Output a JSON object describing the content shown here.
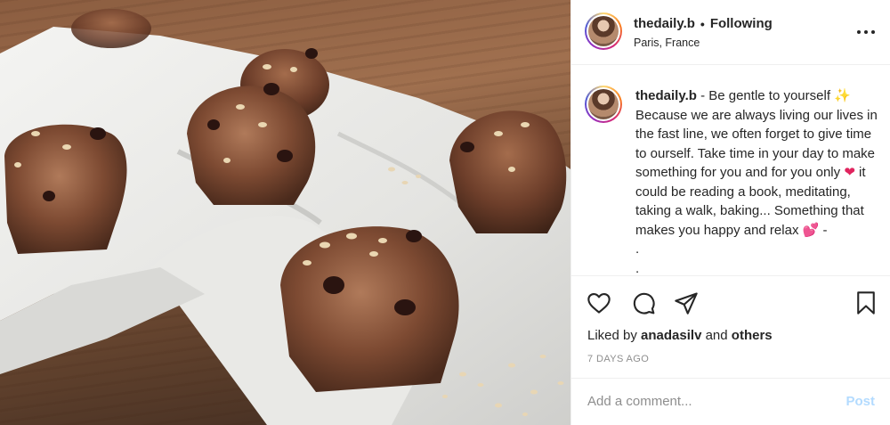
{
  "post": {
    "username": "thedaily.b",
    "separator": "•",
    "follow_status": "Following",
    "location": "Paris, France",
    "caption_user": "thedaily.b",
    "caption_lines": [
      " - Be gentle to yourself ",
      "Because we are always living our lives in the fast line, we often forget to give time to ourself. Take time in your day to make something for you and for you only ",
      " it could be reading a book, meditating, taking a walk, baking... Something that makes you happy and relax ",
      " -",
      ".",
      "."
    ],
    "emoji": {
      "sparkle": "✨",
      "red_heart": "❤",
      "pink_hearts": "💕"
    },
    "likes_prefix": "Liked by",
    "likes_user": "anadasilv",
    "likes_and": "and",
    "likes_others": "others",
    "timestamp": "7 DAYS AGO",
    "comment_placeholder": "Add a comment...",
    "post_button": "Post"
  },
  "icons": {
    "more": "more-options-icon",
    "like": "heart-icon",
    "comment": "comment-icon",
    "share": "paper-plane-icon",
    "save": "bookmark-icon"
  },
  "colors": {
    "accent_disabled": "#b3dbff",
    "muted": "#8e8e8e",
    "text": "#262626"
  }
}
